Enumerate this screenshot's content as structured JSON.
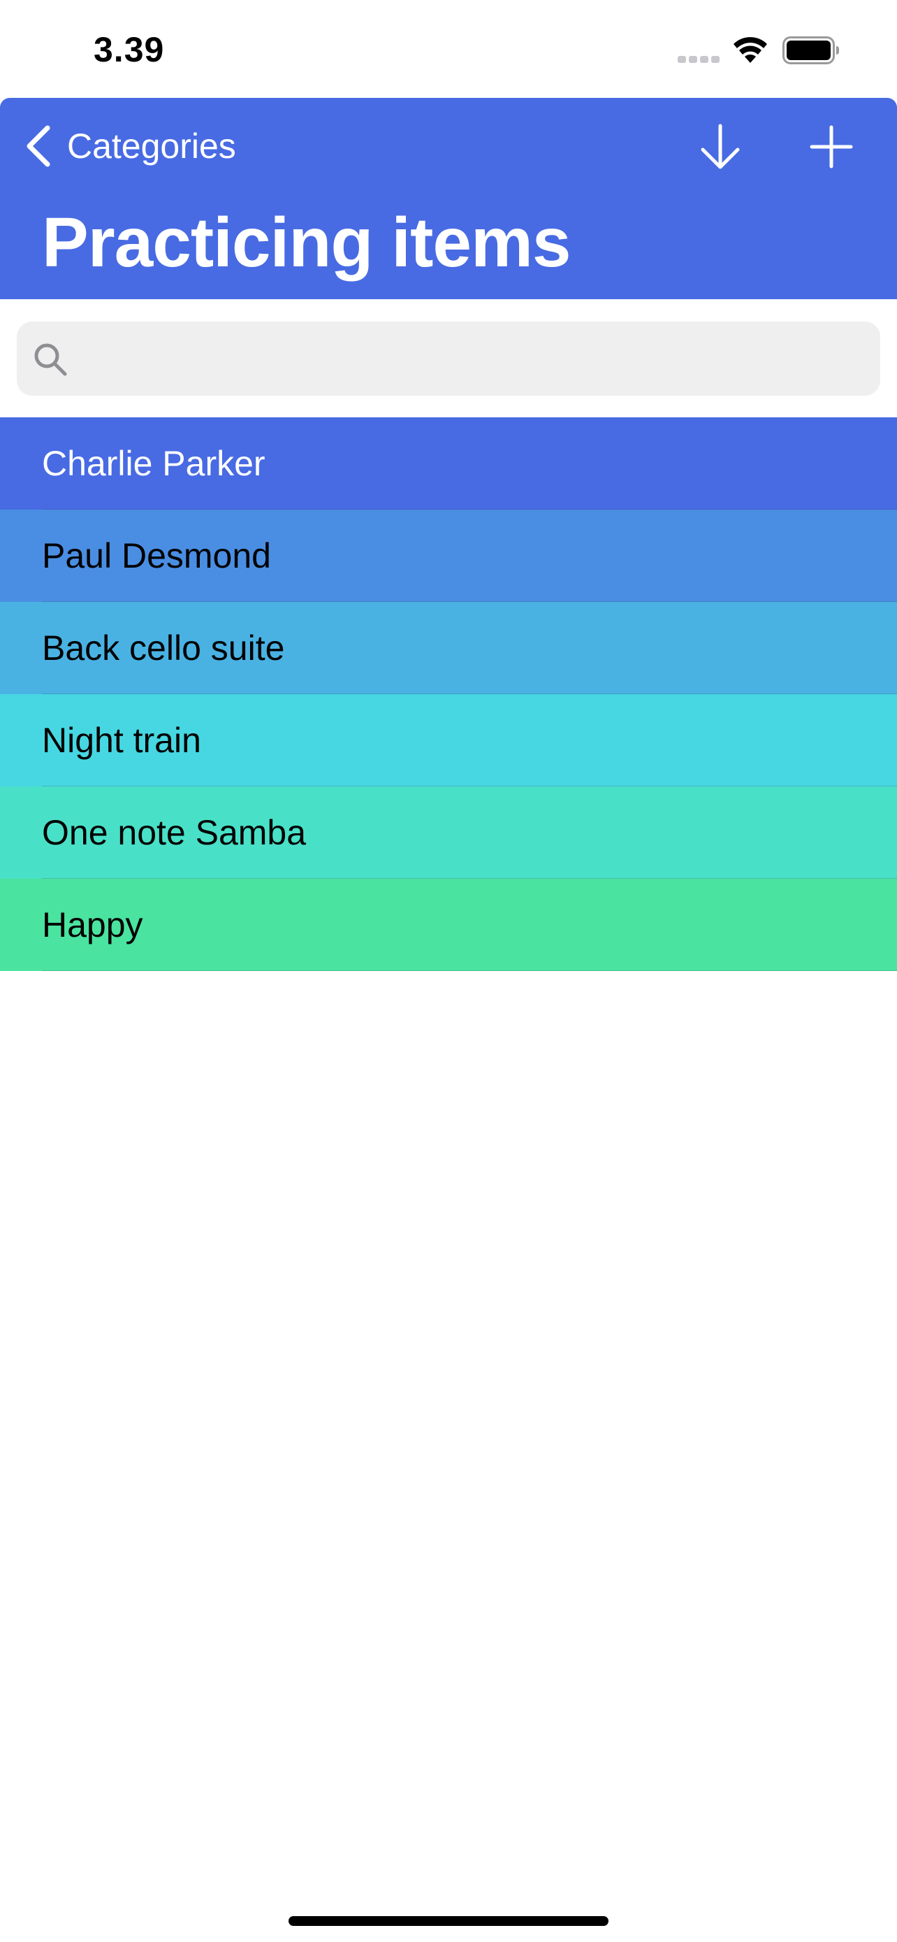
{
  "status_bar": {
    "time": "3.39"
  },
  "nav": {
    "back_label": "Categories",
    "title": "Practicing items",
    "accent_color": "#486be3",
    "icons": {
      "back": "chevron-left-icon",
      "sort": "arrow-down-icon",
      "add": "plus-icon"
    }
  },
  "search": {
    "placeholder": "",
    "value": "",
    "icon": "search-icon"
  },
  "items": [
    {
      "label": "Charlie Parker",
      "background": "#486be3",
      "text_color": "#ffffff"
    },
    {
      "label": "Paul Desmond",
      "background": "#4a8ee3",
      "text_color": "#000000"
    },
    {
      "label": "Back cello suite",
      "background": "#49b2e3",
      "text_color": "#000000"
    },
    {
      "label": "Night train",
      "background": "#46d7e2",
      "text_color": "#000000"
    },
    {
      "label": "One note Samba",
      "background": "#48e1c8",
      "text_color": "#000000"
    },
    {
      "label": "Happy",
      "background": "#4ae3a0",
      "text_color": "#000000"
    }
  ]
}
